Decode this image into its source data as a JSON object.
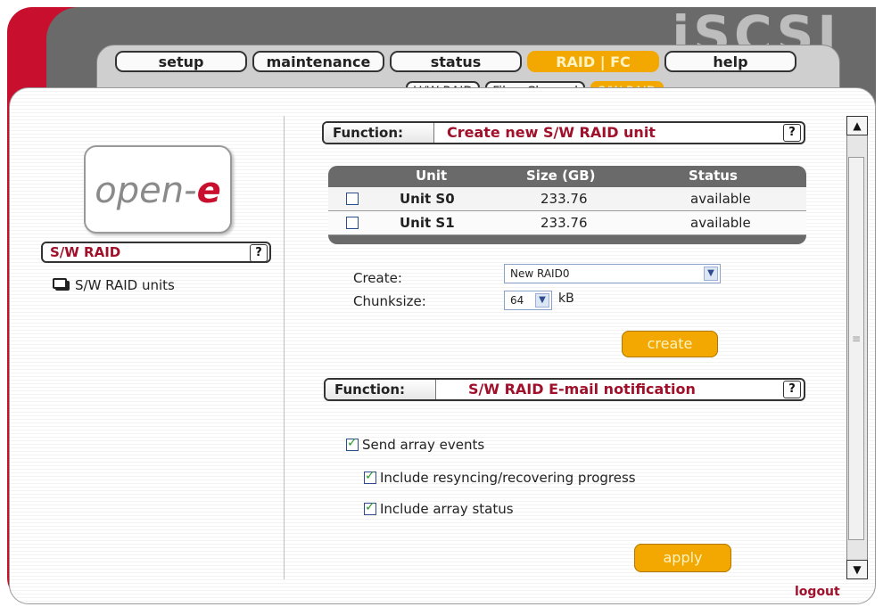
{
  "brand": "iSCSI",
  "logo": {
    "text_main": "open-",
    "text_e": "e"
  },
  "main_tabs": [
    {
      "label": "setup",
      "active": false
    },
    {
      "label": "maintenance",
      "active": false
    },
    {
      "label": "status",
      "active": false
    },
    {
      "label": "RAID | FC",
      "active": true
    },
    {
      "label": "help",
      "active": false
    }
  ],
  "sub_tabs": [
    {
      "label": "H/W RAID",
      "active": false
    },
    {
      "label": "Fibre Channel",
      "active": false
    },
    {
      "label": "S/W RAID",
      "active": true
    }
  ],
  "sidebar": {
    "section_title": "S/W RAID",
    "help": "?",
    "items": [
      {
        "label": "S/W RAID units",
        "icon": "disk-icon"
      }
    ]
  },
  "function1": {
    "label": "Function:",
    "title": "Create new S/W RAID unit",
    "help": "?",
    "table": {
      "headers": [
        "Unit",
        "Size (GB)",
        "Status"
      ],
      "rows": [
        {
          "unit": "Unit S0",
          "size": "233.76",
          "status": "available",
          "checked": false
        },
        {
          "unit": "Unit S1",
          "size": "233.76",
          "status": "available",
          "checked": false
        }
      ]
    },
    "create_label": "Create:",
    "create_value": "New RAID0",
    "chunksize_label": "Chunksize:",
    "chunksize_value": "64",
    "chunksize_unit": "kB",
    "create_button": "create"
  },
  "function2": {
    "label": "Function:",
    "title": "S/W RAID E-mail notification",
    "help": "?",
    "options": [
      {
        "label": "Send array events",
        "checked": true
      },
      {
        "label": "Include resyncing/recovering progress",
        "checked": true
      },
      {
        "label": "Include array status",
        "checked": true
      }
    ],
    "apply_button": "apply"
  },
  "logout": "logout",
  "colors": {
    "accent": "#f2a800",
    "brand_red": "#c8102e",
    "title_red": "#a0102a"
  }
}
